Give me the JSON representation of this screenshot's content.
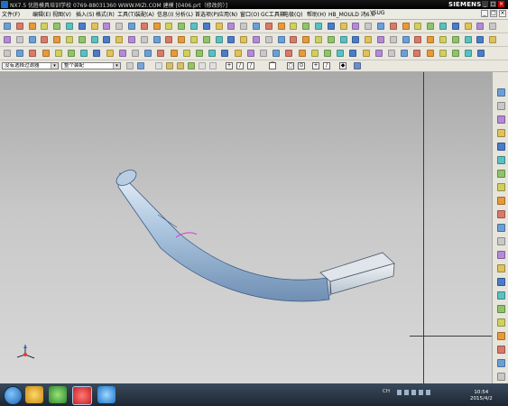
{
  "window": {
    "title": "NX7.5  优胜模具培训学校  0769-88031360  WWW.MIZI.COM  建模  [0406.prt（修改的）]",
    "brand": "SIEMENS",
    "controls": {
      "minimize": "_",
      "maximize": "□",
      "close": "×"
    }
  },
  "menu": {
    "items": [
      "文件(F)",
      "编辑(E)",
      "视图(V)",
      "插入(S)",
      "格式(R)",
      "工具(T)",
      "装配(A)",
      "信息(I)",
      "分析(L)",
      "首选项(P)",
      "应用(N)",
      "窗口(O)",
      "GC工具箱",
      "电极(Q)",
      "帮助(H)",
      "HB_MOULD 鸿6.6",
      "YSUG"
    ]
  },
  "selection_bar": {
    "filter": "没有选择过滤器",
    "scope": "整个装配"
  },
  "snap_buttons": [
    "+",
    "/",
    "/",
    "⌒",
    "○",
    "⊙",
    "+",
    "/",
    "◆"
  ],
  "taskbar": {
    "tray_lang": "CH",
    "time": "10:54",
    "date": "2015/4/2"
  },
  "colors": {
    "accent": "#1b6fc9",
    "model_body": "#aac4de",
    "model_edge": "#3a5a86",
    "highlight": "#d63cd6"
  }
}
